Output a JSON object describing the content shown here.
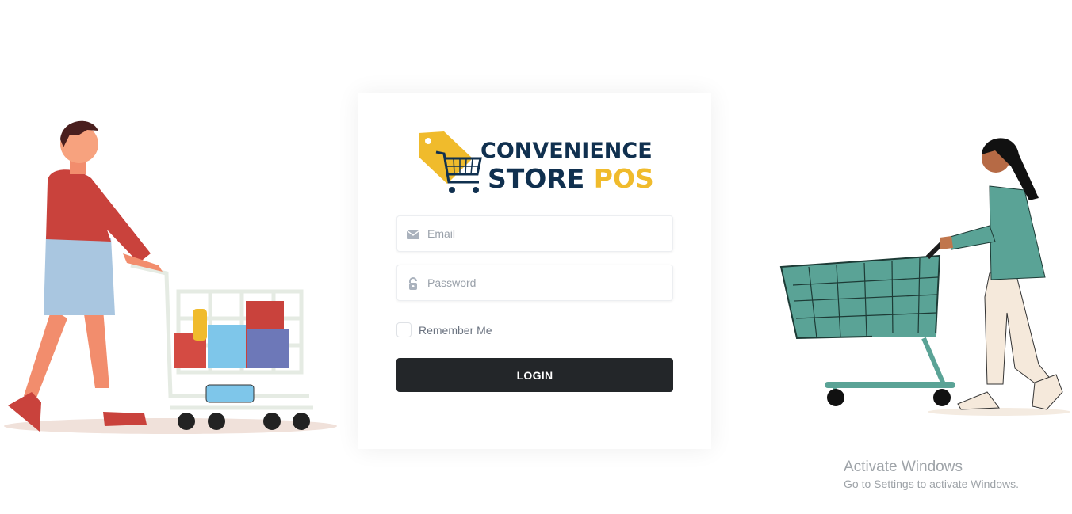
{
  "brand": {
    "line1": "CONVENIENCE",
    "line2a": "STORE ",
    "line2b": "POS"
  },
  "login_form": {
    "email_placeholder": "Email",
    "password_placeholder": "Password",
    "remember_label": "Remember Me",
    "login_label": "LOGIN"
  },
  "icons": {
    "email": "envelope-icon",
    "password": "lock-icon"
  },
  "colors": {
    "brand_navy": "#10304f",
    "brand_yellow": "#f0bb2c",
    "button": "#232629",
    "cart_teal": "#5aa396"
  },
  "watermark": {
    "title": "Activate Windows",
    "subtitle": "Go to Settings to activate Windows."
  }
}
